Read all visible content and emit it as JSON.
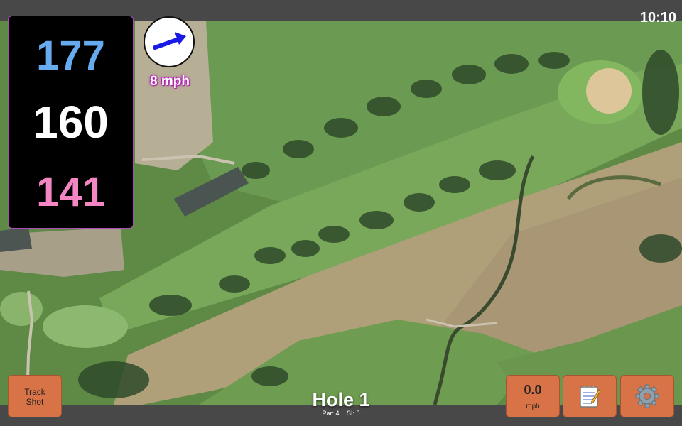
{
  "status_bar": {
    "time": "10:10"
  },
  "distances": {
    "back": {
      "value": "177",
      "color": "#66aaf0"
    },
    "middle": {
      "value": "160",
      "color": "#ffffff"
    },
    "front": {
      "value": "141",
      "color": "#f585c3"
    }
  },
  "wind": {
    "speed_label": "8 mph",
    "arrow_icon": "arrow-right-icon",
    "arrow_color": "#1a1ae6"
  },
  "hole": {
    "title": "Hole 1",
    "par": "Par: 4",
    "stroke_index": "SI: 5"
  },
  "buttons": {
    "track_shot": {
      "line1": "Track",
      "line2": "Shot"
    },
    "speed": {
      "value": "0.0",
      "unit": "mph"
    },
    "notes": {
      "icon": "notepad-icon"
    },
    "settings": {
      "icon": "gear-icon"
    }
  },
  "colors": {
    "button_bg": "#d77346",
    "panel_border": "#b04cb8"
  }
}
